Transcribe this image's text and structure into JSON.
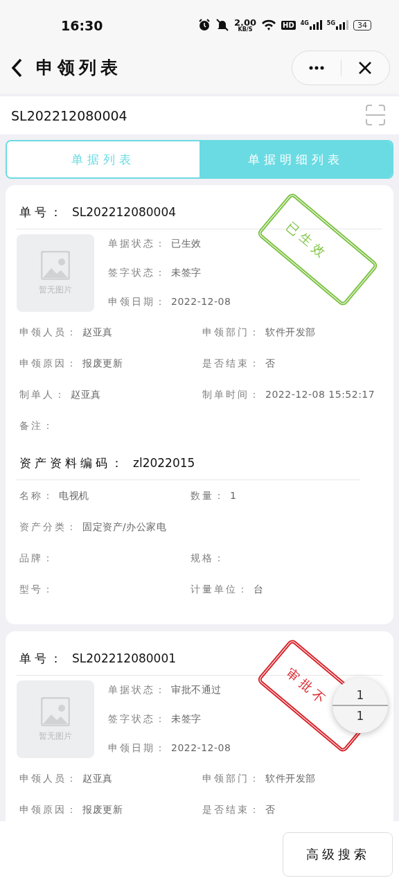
{
  "status_bar": {
    "time": "16:30",
    "net_speed": "2.00",
    "net_unit": "KB/S",
    "hd": "HD",
    "sim1": "4G",
    "sim2": "5G",
    "battery": "34"
  },
  "nav": {
    "title": "申领列表"
  },
  "search": {
    "value": "SL202212080004"
  },
  "tabs": [
    {
      "label": "单据列表",
      "selected": false
    },
    {
      "label": "单据明细列表",
      "selected": true
    }
  ],
  "cards": [
    {
      "number_label": "单号：",
      "number": "SL202212080004",
      "photo_text": "暂无图片",
      "stamp": {
        "text": "已生效",
        "color": "#7cc242"
      },
      "info": [
        {
          "label": "单据状态：",
          "value": "已生效"
        },
        {
          "label": "签字状态：",
          "value": "未签字"
        },
        {
          "label": "申领日期：",
          "value": "2022-12-08"
        }
      ],
      "rows": [
        [
          {
            "label": "申领人员：",
            "value": "赵亚真"
          },
          {
            "label": "申领部门：",
            "value": "软件开发部"
          }
        ],
        [
          {
            "label": "申领原因：",
            "value": "报废更新"
          },
          {
            "label": "是否结束：",
            "value": "否"
          }
        ],
        [
          {
            "label": "制单人：",
            "value": "赵亚真"
          },
          {
            "label": "制单时间：",
            "value": "2022-12-08 15:52:17"
          }
        ],
        [
          {
            "label": "备注："
          }
        ]
      ],
      "asset": {
        "label": "资产资料编码：",
        "value": "zl2022015",
        "rows": [
          [
            {
              "label": "名称：",
              "value": "电视机"
            },
            {
              "label": "数量：",
              "value": "1"
            }
          ],
          [
            {
              "label": "资产分类：",
              "value": "固定资产/办公家电"
            }
          ],
          [
            {
              "label": "品牌："
            },
            {
              "label": "规格："
            }
          ],
          [
            {
              "label": "型号："
            },
            {
              "label": "计量单位：",
              "value": "台"
            }
          ]
        ]
      }
    },
    {
      "number_label": "单号：",
      "number": "SL202212080001",
      "photo_text": "暂无图片",
      "stamp": {
        "text": "审批不",
        "color": "#d8232a"
      },
      "info": [
        {
          "label": "单据状态：",
          "value": "审批不通过"
        },
        {
          "label": "签字状态：",
          "value": "未签字"
        },
        {
          "label": "申领日期：",
          "value": "2022-12-08"
        }
      ],
      "rows": [
        [
          {
            "label": "申领人员：",
            "value": "赵亚真"
          },
          {
            "label": "申领部门：",
            "value": "软件开发部"
          }
        ],
        [
          {
            "label": "申领原因：",
            "value": "报废更新"
          },
          {
            "label": "是否结束：",
            "value": "否"
          }
        ]
      ]
    }
  ],
  "pager": {
    "current": "1",
    "total": "1"
  },
  "bottom": {
    "button": "高级搜索"
  }
}
